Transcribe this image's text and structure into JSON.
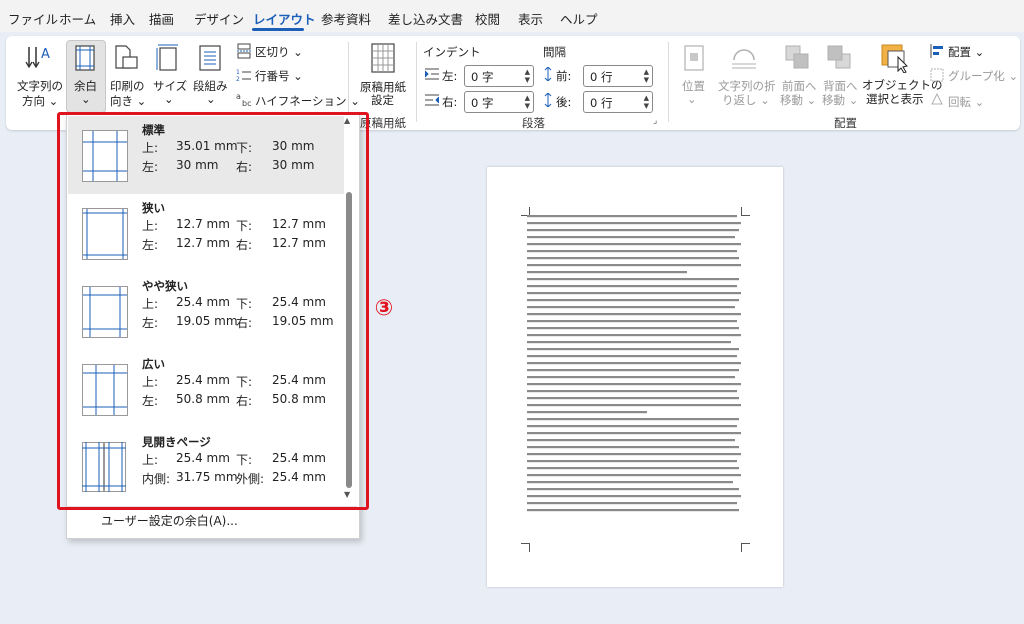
{
  "menu": {
    "tabs": [
      "ファイル",
      "ホーム",
      "挿入",
      "描画",
      "デザイン",
      "レイアウト",
      "参考資料",
      "差し込み文書",
      "校閲",
      "表示",
      "ヘルプ"
    ],
    "active": "レイアウト"
  },
  "ribbon": {
    "text_direction": [
      "文字列の",
      "方向 ⌄"
    ],
    "margins": [
      "余白",
      "⌄"
    ],
    "orientation": [
      "印刷の",
      "向き ⌄"
    ],
    "size": [
      "サイズ",
      "⌄"
    ],
    "columns": [
      "段組み",
      "⌄"
    ],
    "breaks": "区切り ⌄",
    "line_numbers": "行番号 ⌄",
    "hyphenation": "ハイフネーション ⌄",
    "genkou": [
      "原稿用紙",
      "設定"
    ],
    "genkou_group": "原稿用紙",
    "indent_label": "インデント",
    "spacing_label": "間隔",
    "indent_left_label": "左:",
    "indent_left_value": "0 字",
    "indent_right_label": "右:",
    "indent_right_value": "0 字",
    "space_before_label": "前:",
    "space_before_value": "0 行",
    "space_after_label": "後:",
    "space_after_value": "0 行",
    "paragraph_group": "段落",
    "position": [
      "位置",
      "⌄"
    ],
    "wrap_text": [
      "文字列の折",
      "り返し ⌄"
    ],
    "bring_forward": [
      "前面へ",
      "移動 ⌄"
    ],
    "send_backward": [
      "背面へ",
      "移動 ⌄"
    ],
    "selection_pane": [
      "オブジェクトの",
      "選択と表示"
    ],
    "align": "配置 ⌄",
    "group": "グループ化 ⌄",
    "rotate": "回転 ⌄",
    "arrange_group": "配置"
  },
  "margins_menu": {
    "options": [
      {
        "name": "標準",
        "l1a": "上:",
        "l1b": "35.01 mm",
        "l1c": "下:",
        "l1d": "30 mm",
        "l2a": "左:",
        "l2b": "30 mm",
        "l2c": "右:",
        "l2d": "30 mm"
      },
      {
        "name": "狭い",
        "l1a": "上:",
        "l1b": "12.7 mm",
        "l1c": "下:",
        "l1d": "12.7 mm",
        "l2a": "左:",
        "l2b": "12.7 mm",
        "l2c": "右:",
        "l2d": "12.7 mm"
      },
      {
        "name": "やや狭い",
        "l1a": "上:",
        "l1b": "25.4 mm",
        "l1c": "下:",
        "l1d": "25.4 mm",
        "l2a": "左:",
        "l2b": "19.05 mm",
        "l2c": "右:",
        "l2d": "19.05 mm"
      },
      {
        "name": "広い",
        "l1a": "上:",
        "l1b": "25.4 mm",
        "l1c": "下:",
        "l1d": "25.4 mm",
        "l2a": "左:",
        "l2b": "50.8 mm",
        "l2c": "右:",
        "l2d": "50.8 mm"
      },
      {
        "name": "見開きページ",
        "l1a": "上:",
        "l1b": "25.4 mm",
        "l1c": "下:",
        "l1d": "25.4 mm",
        "l2a": "内側:",
        "l2b": "31.75 mm",
        "l2c": "外側:",
        "l2d": "25.4 mm"
      }
    ],
    "custom": "ユーザー設定の余白(A)..."
  },
  "annotation": {
    "step": "③",
    "color": "#e0141e"
  },
  "colors": {
    "accent": "#1b5fb8",
    "menu_bg": "#f3f3f3",
    "canvas_bg": "#e9eef6"
  }
}
